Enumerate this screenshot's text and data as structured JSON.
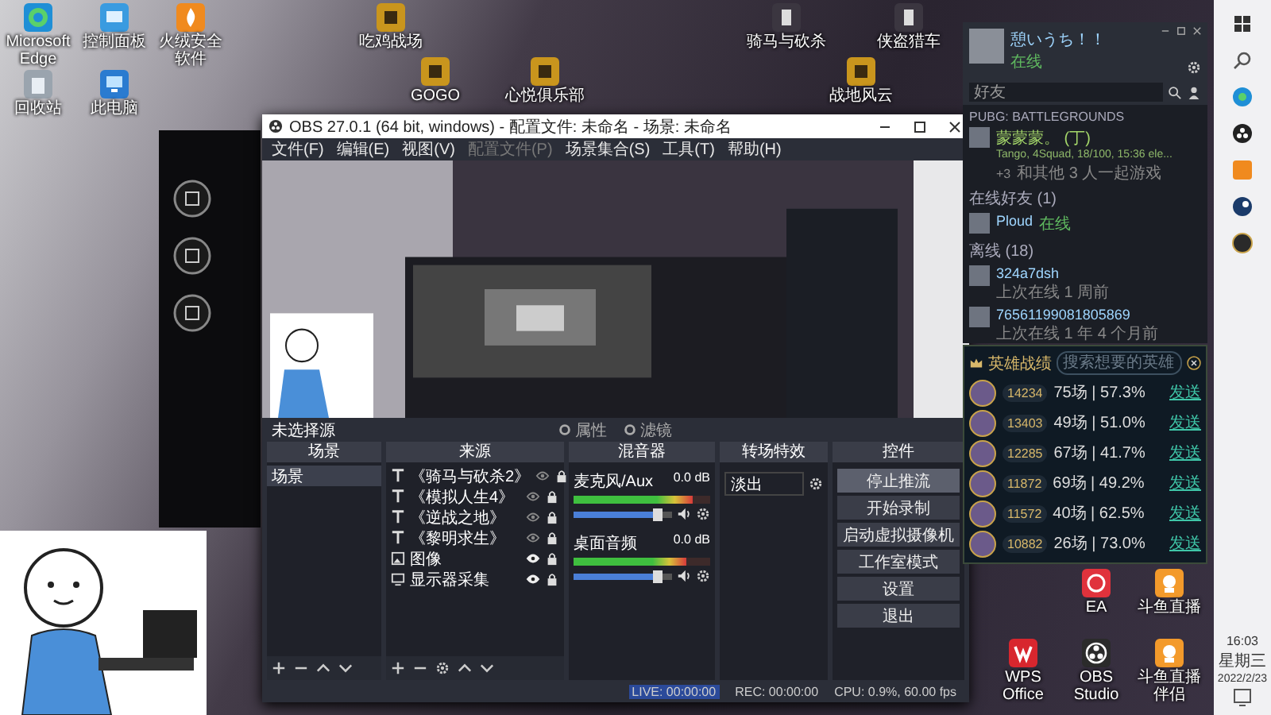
{
  "desktop_icons": {
    "left": [
      {
        "label": "Microsoft Edge",
        "kind": "browser"
      },
      {
        "label": "控制面板",
        "kind": "panel"
      },
      {
        "label": "火绒安全软件",
        "kind": "flame"
      },
      {
        "label": "回收站",
        "kind": "bin"
      },
      {
        "label": "此电脑",
        "kind": "computer"
      }
    ],
    "top": [
      {
        "label": "吃鸡战场",
        "kind": "game"
      },
      {
        "label": "GOGO",
        "kind": "game"
      },
      {
        "label": "心悦俱乐部",
        "kind": "game"
      },
      {
        "label": "骑马与砍杀",
        "kind": "letter"
      },
      {
        "label": "战地风云",
        "kind": "game"
      },
      {
        "label": "侠盗猎车",
        "kind": "letter"
      }
    ],
    "bottom_right": [
      {
        "label": "EA",
        "kind": "ea"
      },
      {
        "label": "斗鱼直播",
        "kind": "mascot"
      },
      {
        "label": "WPS Office",
        "kind": "wps"
      },
      {
        "label": "OBS Studio",
        "kind": "obs"
      },
      {
        "label": "斗鱼直播伴侣",
        "kind": "mascot"
      }
    ]
  },
  "obs": {
    "title": "OBS 27.0.1 (64 bit, windows) - 配置文件: 未命名 - 场景: 未命名",
    "menu": [
      {
        "label": "文件(F)",
        "disabled": false
      },
      {
        "label": "编辑(E)",
        "disabled": false
      },
      {
        "label": "视图(V)",
        "disabled": false
      },
      {
        "label": "配置文件(P)",
        "disabled": true
      },
      {
        "label": "场景集合(S)",
        "disabled": false
      },
      {
        "label": "工具(T)",
        "disabled": false
      },
      {
        "label": "帮助(H)",
        "disabled": false
      }
    ],
    "source_bar": {
      "label": "未选择源",
      "buttons": [
        "属性",
        "滤镜"
      ]
    },
    "docks": {
      "scenes": {
        "title": "场景",
        "items": [
          {
            "label": "场景",
            "selected": true
          }
        ]
      },
      "sources": {
        "title": "来源",
        "items": [
          {
            "label": "《骑马与砍杀2》",
            "kind": "text",
            "visible": false
          },
          {
            "label": "《模拟人生4》",
            "kind": "text",
            "visible": false
          },
          {
            "label": "《逆战之地》",
            "kind": "text",
            "visible": false
          },
          {
            "label": "《黎明求生》",
            "kind": "text",
            "visible": false
          },
          {
            "label": "图像",
            "kind": "image",
            "visible": true
          },
          {
            "label": "显示器采集",
            "kind": "display",
            "visible": true
          }
        ]
      },
      "mixer": {
        "title": "混音器",
        "channels": [
          {
            "name": "麦克风/Aux",
            "reading": "0.0 dB",
            "meter": {
              "level": 0.87
            },
            "fader": {
              "level": 0.9
            }
          },
          {
            "name": "桌面音频",
            "reading": "0.0 dB",
            "meter": {
              "level": 0.82
            },
            "fader": {
              "level": 0.9
            }
          }
        ]
      },
      "transitions": {
        "title": "转场特效",
        "value": "淡出"
      },
      "controls": {
        "title": "控件",
        "buttons": [
          {
            "label": "停止推流",
            "highlighted": true
          },
          {
            "label": "开始录制",
            "highlighted": false
          },
          {
            "label": "启动虚拟摄像机",
            "highlighted": false
          },
          {
            "label": "工作室模式",
            "highlighted": false
          },
          {
            "label": "设置",
            "highlighted": false
          },
          {
            "label": "退出",
            "highlighted": false
          }
        ]
      }
    },
    "status": {
      "live": "LIVE: 00:00:00",
      "rec": "REC: 00:00:00",
      "cpu": "CPU: 0.9%, 60.00 fps"
    }
  },
  "friends": {
    "user": {
      "name": "憩いうち！！",
      "status": "在线"
    },
    "search": {
      "placeholder": "好友"
    },
    "game": {
      "title": "PUBG: BATTLEGROUNDS",
      "friend": {
        "name": "蒙蒙蒙。",
        "tag": "(丁)",
        "detail": "Tango, 4Squad, 18/100, 15:36 ele...",
        "extra": "+3",
        "note": "和其他 3 人一起游戏"
      }
    },
    "online": {
      "title": "在线好友 (1)",
      "friends": [
        {
          "name": "Ploud",
          "status": "在线"
        }
      ]
    },
    "offline": {
      "title": "离线 (18)",
      "friends": [
        {
          "name": "324a7dsh",
          "status": "上次在线 1 周前"
        },
        {
          "name": "76561199081805869",
          "status": "上次在线 1 年 4 个月前"
        }
      ]
    }
  },
  "heroes": {
    "title": "英雄战绩",
    "search": {
      "placeholder": "搜索想要的英雄"
    },
    "rows": [
      {
        "score": "14234",
        "record": "75场 | 57.3%",
        "action": "发送"
      },
      {
        "score": "13403",
        "record": "49场 | 51.0%",
        "action": "发送"
      },
      {
        "score": "12285",
        "record": "67场 | 41.7%",
        "action": "发送"
      },
      {
        "score": "11872",
        "record": "69场 | 49.2%",
        "action": "发送"
      },
      {
        "score": "11572",
        "record": "40场 | 62.5%",
        "action": "发送"
      },
      {
        "score": "10882",
        "record": "26场 | 73.0%",
        "action": "发送"
      }
    ]
  },
  "taskbar": {
    "clock": {
      "time": "16:03",
      "weekday": "星期三",
      "date": "2022/2/23"
    }
  }
}
